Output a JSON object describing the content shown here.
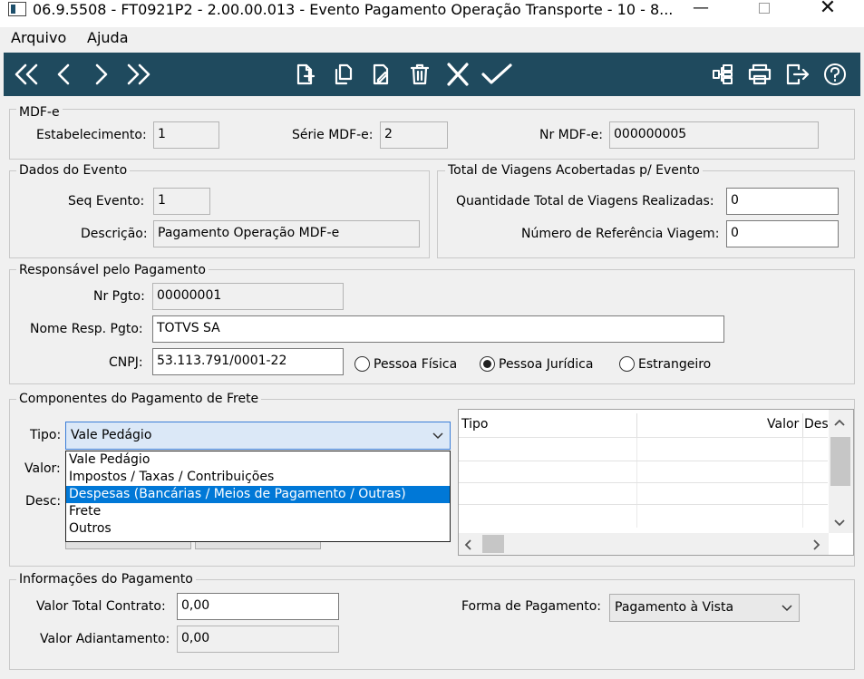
{
  "window": {
    "title": "06.9.5508 - FT0921P2 - 2.00.00.013 - Evento Pagamento Operação Transporte - 10 - 8..."
  },
  "menu": {
    "arquivo": "Arquivo",
    "ajuda": "Ajuda"
  },
  "toolbar": {
    "buttons": [
      "first-icon",
      "previous-icon",
      "next-icon",
      "last-icon",
      "new-document-icon",
      "copy-icon",
      "edit-icon",
      "delete-icon",
      "cancel-icon",
      "confirm-icon",
      "tree-icon",
      "print-icon",
      "exit-icon",
      "help-icon"
    ]
  },
  "mdfe": {
    "group": "MDF-e",
    "estab_label": "Estabelecimento:",
    "estab_value": "1",
    "serie_label": "Série MDF-e:",
    "serie_value": "2",
    "nr_label": "Nr MDF-e:",
    "nr_value": "000000005"
  },
  "evento": {
    "group": "Dados do Evento",
    "seq_label": "Seq Evento:",
    "seq_value": "1",
    "desc_label": "Descrição:",
    "desc_value": "Pagamento Operação MDF-e"
  },
  "viagens": {
    "group": "Total de Viagens Acobertadas p/ Evento",
    "qtd_label": "Quantidade Total de Viagens Realizadas:",
    "qtd_value": "0",
    "ref_label": "Número de Referência Viagem:",
    "ref_value": "0"
  },
  "responsavel": {
    "group": "Responsável pelo Pagamento",
    "nr_label": "Nr Pgto:",
    "nr_value": "00000001",
    "nome_label": "Nome Resp. Pgto:",
    "nome_value": "TOTVS SA",
    "cnpj_label": "CNPJ:",
    "cnpj_value": "53.113.791/0001-22",
    "radios": [
      "Pessoa Física",
      "Pessoa Jurídica",
      "Estrangeiro"
    ],
    "selected": "Pessoa Jurídica"
  },
  "componentes": {
    "group": "Componentes do Pagamento de Frete",
    "tipo_label": "Tipo:",
    "tipo_value": "Vale Pedágio",
    "valor_label": "Valor:",
    "desc_label": "Desc:",
    "options": [
      "Vale Pedágio",
      "Impostos / Taxas / Contribuições",
      "Despesas (Bancárias / Meios de Pagamento / Outras)",
      "Frete",
      "Outros"
    ],
    "grid_cols": [
      "Tipo",
      "Valor",
      "Des"
    ]
  },
  "informacoes": {
    "group": "Informações do Pagamento",
    "total_label": "Valor Total Contrato:",
    "total_value": "0,00",
    "adiant_label": "Valor Adiantamento:",
    "adiant_value": "0,00",
    "forma_label": "Forma de Pagamento:",
    "forma_value": "Pagamento à Vista"
  },
  "colors": {
    "toolbar": "#1f4a5e",
    "selection": "#0078d7"
  }
}
